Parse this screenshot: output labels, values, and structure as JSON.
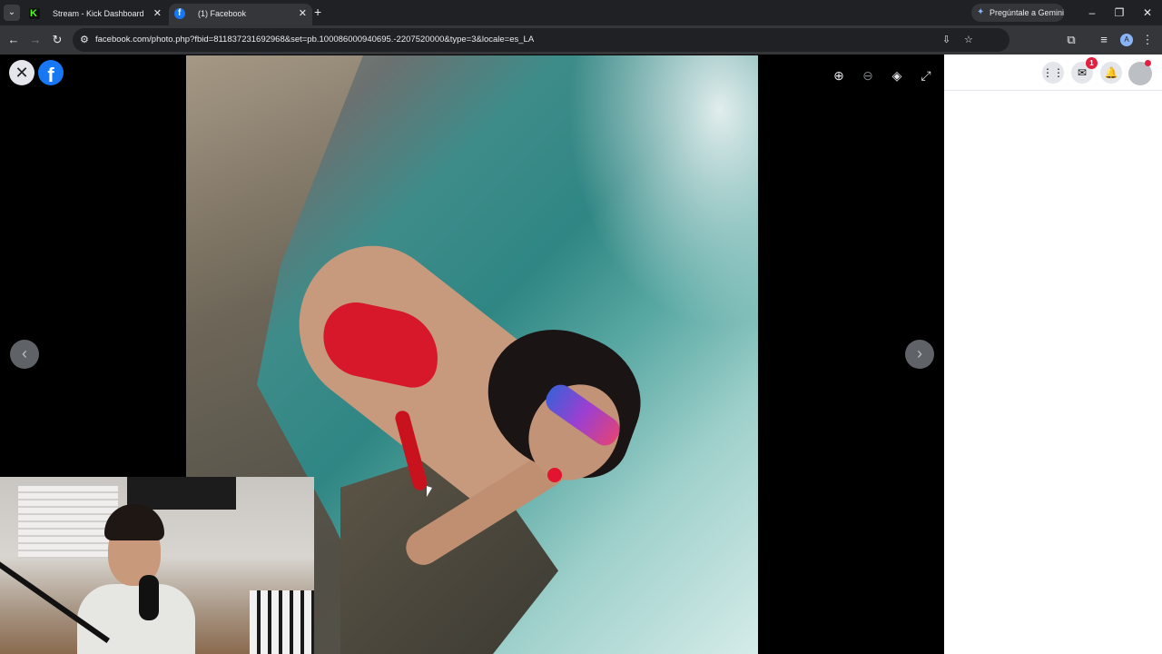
{
  "browser": {
    "tabs": [
      {
        "title": "Stream - Kick Dashboard",
        "favicon": "kick-icon",
        "active": false
      },
      {
        "title": "(1) Facebook",
        "favicon": "facebook-icon",
        "active": true
      }
    ],
    "gemini_label": "Pregúntale a Gemini",
    "url": "facebook.com/photo.php?fbid=811837231692968&set=pb.100086000940695.-2207520000&type=3&locale=es_LA",
    "profile_initial": "A"
  },
  "viewer": {
    "photo_alt": "Photo",
    "tools": [
      "zoom-in-icon",
      "zoom-out-icon",
      "tag-icon",
      "fullscreen-icon"
    ]
  },
  "header": {
    "messenger_badge": "1"
  },
  "colors": {
    "facebook_blue": "#1877f2",
    "badge_red": "#e41e3f",
    "chrome_dark": "#202124"
  }
}
